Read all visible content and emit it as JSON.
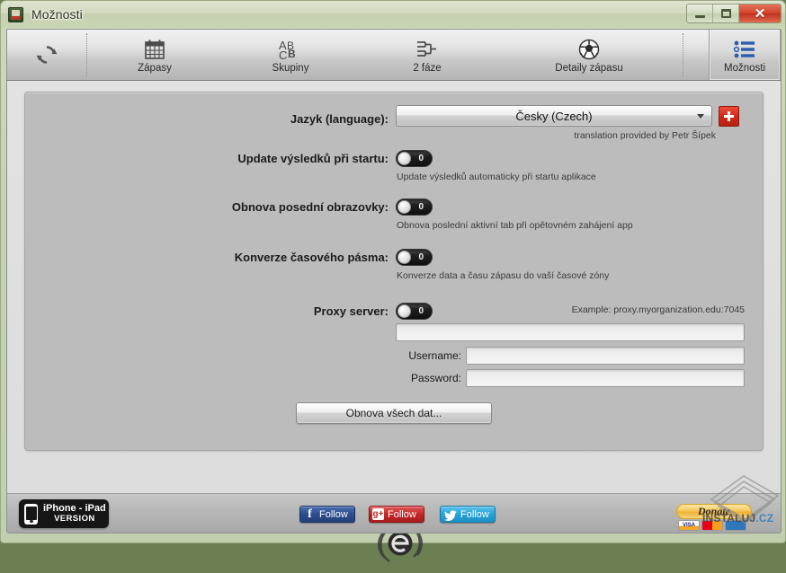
{
  "window": {
    "title": "Možnosti",
    "icon": "app-icon",
    "controls": {
      "minimize": "minimize-button",
      "maximize": "maximize-button",
      "close_glyph": "✕"
    }
  },
  "toolbar": {
    "items": [
      {
        "id": "refresh",
        "label": "",
        "icon": "refresh-icon"
      },
      {
        "id": "zapasy",
        "label": "Zápasy",
        "icon": "calendar-icon"
      },
      {
        "id": "skupiny",
        "label": "Skupiny",
        "icon": "abc-icon"
      },
      {
        "id": "faze",
        "label": "2 fáze",
        "icon": "bracket-icon"
      },
      {
        "id": "detaily",
        "label": "Detaily zápasu",
        "icon": "soccer-ball-icon"
      },
      {
        "id": "moznosti",
        "label": "Možnosti",
        "icon": "list-icon"
      }
    ],
    "active": "moznosti"
  },
  "settings": {
    "language": {
      "label": "Jazyk (language):",
      "value": "Česky (Czech)",
      "options": [
        "Česky (Czech)"
      ],
      "add_button": "add-language-button",
      "credit": "translation provided by Petr Šípek"
    },
    "update_on_start": {
      "label": "Update výsledků při startu:",
      "state": "0",
      "hint": "Update výsledků automaticky při startu aplikace"
    },
    "restore_screen": {
      "label": "Obnova posední obrazovky:",
      "state": "0",
      "hint": "Obnova poslední aktivní tab při opětovném zahájení app"
    },
    "timezone_conversion": {
      "label": "Konverze časového pásma:",
      "state": "0",
      "hint": "Konverze data a času zápasu do vaší časové zóny"
    },
    "proxy": {
      "label": "Proxy server:",
      "state": "0",
      "example": "Example: proxy.myorganization.edu:7045",
      "host_value": "",
      "username_label": "Username:",
      "username_value": "",
      "password_label": "Password:",
      "password_value": ""
    },
    "reset_button": "Obnova všech dat..."
  },
  "footer": {
    "iphone_badge": {
      "line1": "iPhone - iPad",
      "line2": "VERSION"
    },
    "social": [
      {
        "id": "facebook",
        "glyph": "f",
        "label": "Follow",
        "color": "#2c4d8e"
      },
      {
        "id": "googleplus",
        "glyph": "g",
        "label": "Follow",
        "color": "#c42727"
      },
      {
        "id": "twitter",
        "glyph": "t",
        "label": "Follow",
        "color": "#28a3d8"
      }
    ],
    "donate": "Donate",
    "cards": [
      "VISA",
      "MC",
      "AE"
    ]
  },
  "watermark": {
    "part1": "INSTALUJ",
    "part2": ".CZ"
  }
}
